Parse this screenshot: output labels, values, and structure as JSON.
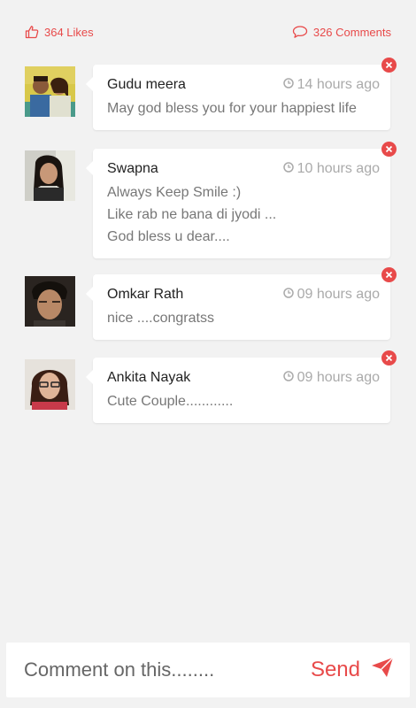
{
  "stats": {
    "likes_label": "364 Likes",
    "comments_label": "326 Comments"
  },
  "comments": [
    {
      "name": "Gudu meera",
      "time": "14 hours ago",
      "lines": [
        "May god bless you for your happiest life"
      ],
      "avatar_icon": "couple-photo"
    },
    {
      "name": "Swapna",
      "time": "10 hours ago",
      "lines": [
        "Always Keep Smile :)",
        "Like rab ne bana di jyodi ...",
        "God bless u dear...."
      ],
      "avatar_icon": "woman-photo"
    },
    {
      "name": "Omkar Rath",
      "time": "09 hours ago",
      "lines": [
        "nice ....congratss"
      ],
      "avatar_icon": "man-photo"
    },
    {
      "name": "Ankita Nayak",
      "time": "09 hours ago",
      "lines": [
        "Cute Couple............"
      ],
      "avatar_icon": "woman-glasses-photo"
    }
  ],
  "composer": {
    "placeholder": "Comment on this........",
    "send_label": "Send"
  },
  "colors": {
    "accent": "#e84a4a",
    "background": "#f2f2f2",
    "card": "#ffffff"
  }
}
